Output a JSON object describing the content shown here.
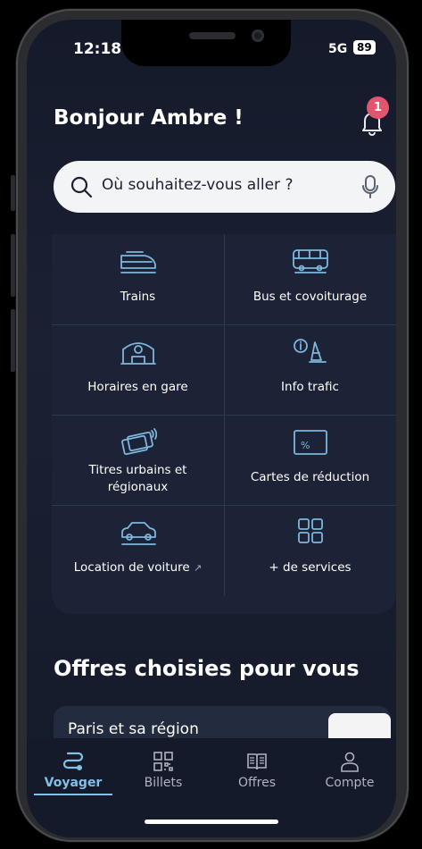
{
  "status_bar": {
    "time": "12:18",
    "network": "5G",
    "battery": "89"
  },
  "header": {
    "greeting": "Bonjour Ambre !",
    "notification_count": "1"
  },
  "search": {
    "placeholder": "Où souhaitez-vous aller ?"
  },
  "services": [
    {
      "label": "Trains",
      "icon": "train-icon"
    },
    {
      "label": "Bus et covoiturage",
      "icon": "bus-icon"
    },
    {
      "label": "Horaires en gare",
      "icon": "station-clock-icon"
    },
    {
      "label": "Info trafic",
      "icon": "traffic-info-icon"
    },
    {
      "label": "Titres urbains et régionaux",
      "icon": "transit-cards-icon"
    },
    {
      "label": "Cartes de réduction",
      "icon": "discount-card-icon"
    },
    {
      "label": "Location de voiture",
      "icon": "car-icon"
    },
    {
      "label": "+ de services",
      "icon": "grid-icon"
    }
  ],
  "offers": {
    "title": "Offres choisies pour vous",
    "first_card_title": "Paris et sa région"
  },
  "tabs": [
    {
      "label": "Voyager",
      "active": true,
      "icon": "route-icon"
    },
    {
      "label": "Billets",
      "active": false,
      "icon": "qr-code-icon"
    },
    {
      "label": "Offres",
      "active": false,
      "icon": "book-icon"
    },
    {
      "label": "Compte",
      "active": false,
      "icon": "user-icon"
    }
  ],
  "colors": {
    "accent": "#84c0e6",
    "badge": "#e25570",
    "background": "#1a2133"
  }
}
